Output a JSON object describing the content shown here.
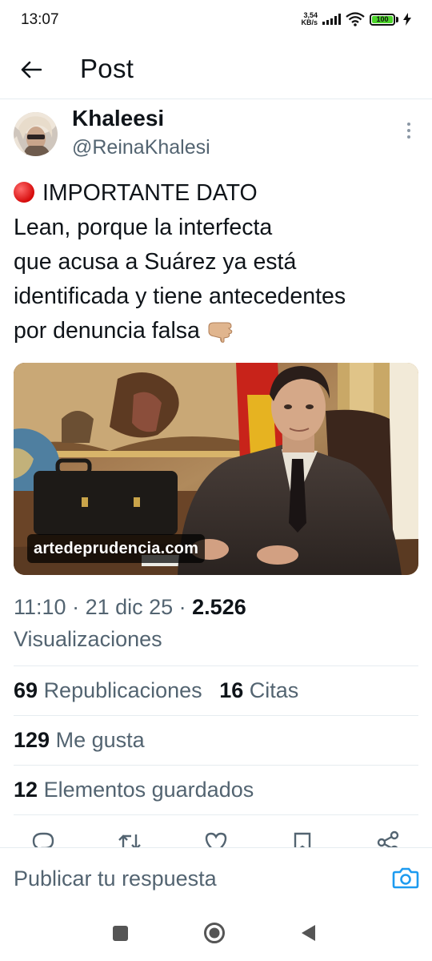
{
  "status_bar": {
    "time": "13:07",
    "net_speed_value": "3,54",
    "net_speed_unit": "KB/s",
    "battery": "100",
    "battery_level": 1.0
  },
  "header": {
    "title": "Post"
  },
  "post": {
    "author_name": "Khaleesi",
    "author_handle": "@ReinaKhalesi",
    "text_lines": [
      "IMPORTANTE DATO",
      "Lean, porque la interfecta",
      "que acusa a Suárez ya está",
      "identificada y tiene antecedentes",
      "por denuncia falsa"
    ],
    "media_badge": "artedeprudencia.com",
    "time": "11:10",
    "date": "21 dic 25",
    "views": "2.526",
    "views_label": "Visualizaciones",
    "reposts": "69",
    "reposts_label": "Republicaciones",
    "quotes": "16",
    "quotes_label": "Citas",
    "likes": "129",
    "likes_label": "Me gusta",
    "bookmarks": "12",
    "bookmarks_label": "Elementos guardados"
  },
  "reply": {
    "placeholder": "Publicar tu respuesta"
  },
  "colors": {
    "accent": "#1d9bf0",
    "secondary_text": "#536471",
    "primary_text": "#0f1419",
    "divider": "#e6ecf0"
  },
  "icons": {
    "back": "arrow-left-icon",
    "more": "vertical-dots-icon",
    "reply": "comment-icon",
    "repost": "repost-icon",
    "like": "heart-icon",
    "bookmark": "bookmark-icon",
    "share": "share-icon",
    "camera": "camera-icon"
  }
}
